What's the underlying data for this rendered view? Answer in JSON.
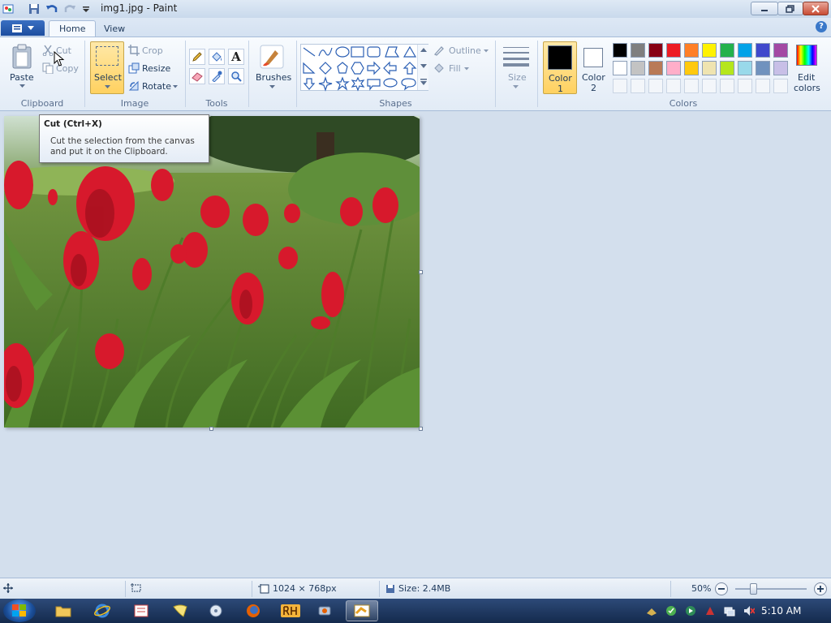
{
  "window": {
    "title": "img1.jpg - Paint"
  },
  "tabs": [
    {
      "label": "Home"
    },
    {
      "label": "View"
    }
  ],
  "clipboard": {
    "paste": "Paste",
    "cut": "Cut",
    "copy": "Copy",
    "group": "Clipboard"
  },
  "image_group": {
    "select": "Select",
    "crop": "Crop",
    "resize": "Resize",
    "rotate": "Rotate",
    "group": "Image"
  },
  "tools_group": {
    "group": "Tools"
  },
  "brushes": {
    "label": "Brushes"
  },
  "shapes_group": {
    "outline": "Outline",
    "fill": "Fill",
    "group": "Shapes"
  },
  "size": {
    "label": "Size"
  },
  "colors": {
    "color1": "Color",
    "color1_num": "1",
    "color2": "Color",
    "color2_num": "2",
    "edit": "Edit",
    "edit2": "colors",
    "group": "Colors",
    "palette_row1": [
      "#000000",
      "#7f7f7f",
      "#880015",
      "#ed1c24",
      "#ff7f27",
      "#fff200",
      "#22b14c",
      "#00a2e8",
      "#3f48cc",
      "#a349a4"
    ],
    "palette_row2": [
      "#ffffff",
      "#c3c3c3",
      "#b97a57",
      "#ffaec9",
      "#ffc90e",
      "#efe4b0",
      "#b5e61d",
      "#99d9ea",
      "#7092be",
      "#c8bfe7"
    ]
  },
  "tooltip": {
    "title": "Cut (Ctrl+X)",
    "line1": "Cut the selection from the canvas",
    "line2": "and put it on the Clipboard."
  },
  "status": {
    "dimensions": "1024 × 768px",
    "size": "Size: 2.4MB",
    "zoom": "50%"
  },
  "clock": "5:10 AM"
}
